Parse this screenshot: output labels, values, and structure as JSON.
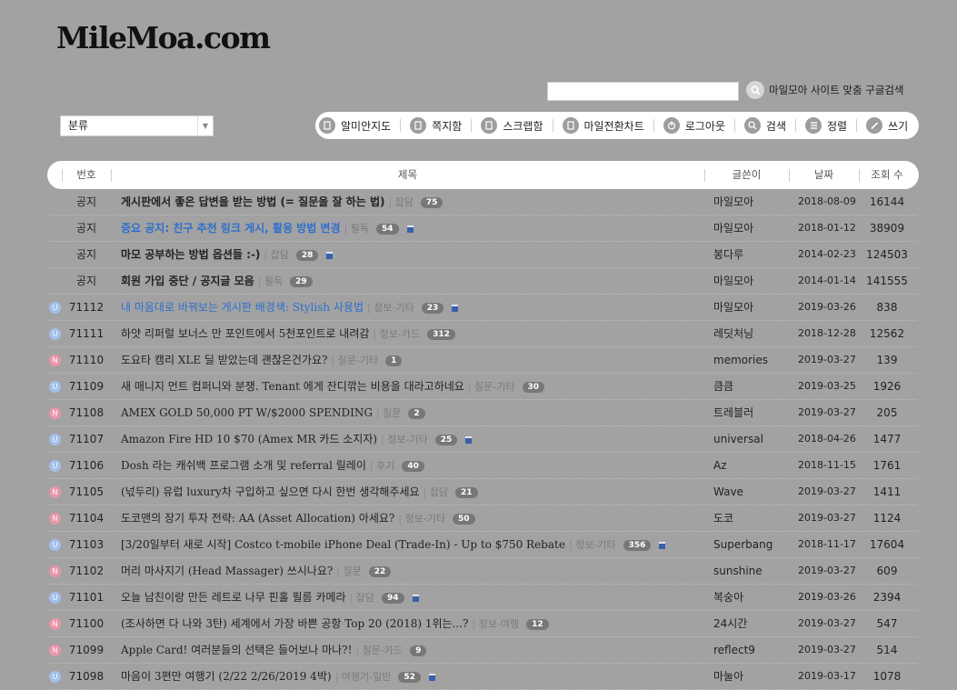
{
  "site": {
    "logo": "MileMoa.com",
    "search_label": "마일모아 사이트 맞춤 구글검색",
    "category_label": "분류"
  },
  "toolbar": {
    "items": [
      {
        "label": "알미안지도",
        "icon": "map-icon"
      },
      {
        "label": "쪽지함",
        "icon": "message-icon"
      },
      {
        "label": "스크랩함",
        "icon": "scrap-icon"
      },
      {
        "label": "마일전환차트",
        "icon": "chart-icon"
      },
      {
        "label": "로그아웃",
        "icon": "power-icon"
      },
      {
        "label": "검색",
        "icon": "search-icon"
      },
      {
        "label": "정렬",
        "icon": "list-icon"
      },
      {
        "label": "쓰기",
        "icon": "pencil-icon"
      }
    ]
  },
  "table": {
    "headers": {
      "no": "번호",
      "title": "제목",
      "author": "글쓴이",
      "date": "날짜",
      "views": "조회 수"
    },
    "rows": [
      {
        "badge": "",
        "no": "공지",
        "title": "게시판에서 좋은 답변을 받는 방법 (= 질문을 잘 하는 법)",
        "category": "잡담",
        "comments": "75",
        "image": false,
        "author": "마일모아",
        "date": "2018-08-09",
        "views": "16144",
        "highlight": false,
        "notice": true
      },
      {
        "badge": "",
        "no": "공지",
        "title": "중요 공지: 친구 추천 링크 게시, 활용 방법 변경",
        "category": "필독",
        "comments": "54",
        "image": true,
        "author": "마일모아",
        "date": "2018-01-12",
        "views": "38909",
        "highlight": true,
        "notice": true
      },
      {
        "badge": "",
        "no": "공지",
        "title": "마모 공부하는 방법 옵션들 :-)",
        "category": "잡담",
        "comments": "28",
        "image": true,
        "author": "봉다루",
        "date": "2014-02-23",
        "views": "124503",
        "highlight": false,
        "notice": true
      },
      {
        "badge": "",
        "no": "공지",
        "title": "회원 가입 중단 / 공지글 모음",
        "category": "필독",
        "comments": "29",
        "image": false,
        "author": "마일모아",
        "date": "2014-01-14",
        "views": "141555",
        "highlight": false,
        "notice": true
      },
      {
        "badge": "U",
        "no": "71112",
        "title": "내 마음대로 바꿔보는 게시판 배경색: Stylish 사용법",
        "category": "정보-기타",
        "comments": "23",
        "image": true,
        "author": "마일모아",
        "date": "2019-03-26",
        "views": "838",
        "highlight": true,
        "notice": false
      },
      {
        "badge": "U",
        "no": "71111",
        "title": "하얏 리퍼럴 보너스 만 포인트에서 5천포인트로 내려감",
        "category": "정보-카드",
        "comments": "312",
        "image": false,
        "author": "레딧처닝",
        "date": "2018-12-28",
        "views": "12562",
        "highlight": false,
        "notice": false
      },
      {
        "badge": "N",
        "no": "71110",
        "title": "도요타 캠리 XLE 딜 받았는데 괜찮은건가요?",
        "category": "질문-기타",
        "comments": "1",
        "image": false,
        "author": "memories",
        "date": "2019-03-27",
        "views": "139",
        "highlight": false,
        "notice": false
      },
      {
        "badge": "U",
        "no": "71109",
        "title": "새 매니지 먼트 컴퍼니와 분쟁. Tenant 에게 잔디깎는 비용을 대라고하네요",
        "category": "질문-기타",
        "comments": "30",
        "image": false,
        "author": "큼큼",
        "date": "2019-03-25",
        "views": "1926",
        "highlight": false,
        "notice": false
      },
      {
        "badge": "N",
        "no": "71108",
        "title": "AMEX GOLD 50,000 PT W/$2000 SPENDING",
        "category": "질문",
        "comments": "2",
        "image": false,
        "author": "트레블러",
        "date": "2019-03-27",
        "views": "205",
        "highlight": false,
        "notice": false
      },
      {
        "badge": "U",
        "no": "71107",
        "title": "Amazon Fire HD 10 $70 (Amex MR 카드 소지자)",
        "category": "정보-기타",
        "comments": "25",
        "image": true,
        "author": "universal",
        "date": "2018-04-26",
        "views": "1477",
        "highlight": false,
        "notice": false
      },
      {
        "badge": "U",
        "no": "71106",
        "title": "Dosh 라는 캐쉬백 프로그램 소개 및 referral 릴레이",
        "category": "후기",
        "comments": "40",
        "image": false,
        "author": "Az",
        "date": "2018-11-15",
        "views": "1761",
        "highlight": false,
        "notice": false
      },
      {
        "badge": "N",
        "no": "71105",
        "title": "(넋두리) 유럽 luxury차 구입하고 싶으면 다시 한번 생각해주세요",
        "category": "잡담",
        "comments": "21",
        "image": false,
        "author": "Wave",
        "date": "2019-03-27",
        "views": "1411",
        "highlight": false,
        "notice": false
      },
      {
        "badge": "N",
        "no": "71104",
        "title": "도코맨의 장기 투자 전략: AA (Asset Allocation) 아세요?",
        "category": "정보-기타",
        "comments": "50",
        "image": false,
        "author": "도코",
        "date": "2019-03-27",
        "views": "1124",
        "highlight": false,
        "notice": false
      },
      {
        "badge": "U",
        "no": "71103",
        "title": "[3/20일부터 새로 시작] Costco t-mobile iPhone Deal (Trade-In) - Up to $750 Rebate",
        "category": "정보-기타",
        "comments": "356",
        "image": true,
        "author": "Superbang",
        "date": "2018-11-17",
        "views": "17604",
        "highlight": false,
        "notice": false
      },
      {
        "badge": "N",
        "no": "71102",
        "title": "머리 마사지기 (Head Massager) 쓰시나요?",
        "category": "질문",
        "comments": "22",
        "image": false,
        "author": "sunshine",
        "date": "2019-03-27",
        "views": "609",
        "highlight": false,
        "notice": false
      },
      {
        "badge": "U",
        "no": "71101",
        "title": "오늘 남친이랑 만든 레트로 나무 핀홀 필름 카메라",
        "category": "잡담",
        "comments": "94",
        "image": true,
        "author": "복숭아",
        "date": "2019-03-26",
        "views": "2394",
        "highlight": false,
        "notice": false
      },
      {
        "badge": "N",
        "no": "71100",
        "title": "(조사하면 다 나와 3탄) 세계에서 가장 바쁜 공항 Top 20 (2018) 1위는...?",
        "category": "정보-여행",
        "comments": "12",
        "image": false,
        "author": "24시간",
        "date": "2019-03-27",
        "views": "547",
        "highlight": false,
        "notice": false
      },
      {
        "badge": "N",
        "no": "71099",
        "title": "Apple Card! 여러분들의 선택은 들어보나 마나?!",
        "category": "질문-카드",
        "comments": "9",
        "image": false,
        "author": "reflect9",
        "date": "2019-03-27",
        "views": "514",
        "highlight": false,
        "notice": false
      },
      {
        "badge": "U",
        "no": "71098",
        "title": "마음이 3편만 여행기 (2/22 2/26/2019 4박)",
        "category": "여행기-일반",
        "comments": "52",
        "image": true,
        "author": "마눌아",
        "date": "2019-03-17",
        "views": "1078",
        "highlight": false,
        "notice": false
      }
    ]
  }
}
